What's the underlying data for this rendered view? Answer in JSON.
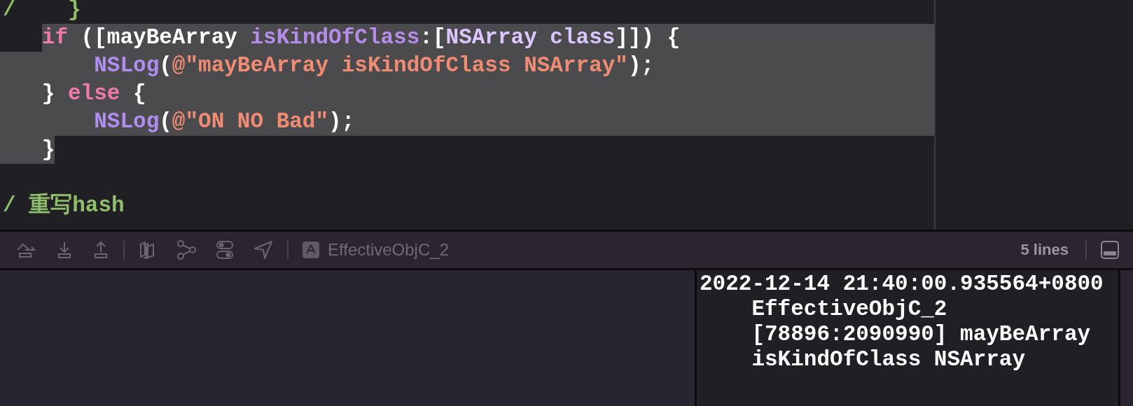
{
  "editor": {
    "lines": [
      {
        "kind": "margin",
        "selected_from_start": false,
        "selected_to_end": false,
        "tokens": [
          {
            "kind": "comment",
            "text": "/    }"
          }
        ]
      },
      {
        "kind": "block",
        "selected_from_start": false,
        "selected_to_end": true,
        "tokens": [
          {
            "kind": "keyword",
            "text": "if"
          },
          {
            "kind": "plain",
            "text": " ([mayBeArray "
          },
          {
            "kind": "method",
            "text": "isKindOfClass"
          },
          {
            "kind": "plain",
            "text": ":["
          },
          {
            "kind": "type",
            "text": "NSArray class"
          },
          {
            "kind": "plain",
            "text": "]]) {"
          }
        ]
      },
      {
        "kind": "nested",
        "selected_from_start": true,
        "selected_to_end": true,
        "tokens": [
          {
            "kind": "function",
            "text": "NSLog"
          },
          {
            "kind": "plain",
            "text": "("
          },
          {
            "kind": "string",
            "text": "@\"mayBeArray isKindOfClass NSArray\""
          },
          {
            "kind": "plain",
            "text": ");"
          }
        ]
      },
      {
        "kind": "block",
        "selected_from_start": true,
        "selected_to_end": true,
        "tokens": [
          {
            "kind": "plain",
            "text": "} "
          },
          {
            "kind": "keyword",
            "text": "else"
          },
          {
            "kind": "plain",
            "text": " {"
          }
        ]
      },
      {
        "kind": "nested",
        "selected_from_start": true,
        "selected_to_end": true,
        "tokens": [
          {
            "kind": "function",
            "text": "NSLog"
          },
          {
            "kind": "plain",
            "text": "("
          },
          {
            "kind": "string",
            "text": "@\"ON NO Bad\""
          },
          {
            "kind": "plain",
            "text": ");"
          }
        ]
      },
      {
        "kind": "block",
        "selected_from_start": true,
        "selected_to_end": false,
        "tokens": [
          {
            "kind": "plain",
            "text": "}"
          }
        ]
      },
      {
        "kind": "blank"
      },
      {
        "kind": "margin",
        "selected_from_start": false,
        "selected_to_end": false,
        "tokens": [
          {
            "kind": "comment",
            "text": "/ 重写hash"
          }
        ]
      }
    ]
  },
  "debug_bar": {
    "target": "EffectiveObjC_2",
    "line_count": "5 lines"
  },
  "console": {
    "output": "2022-12-14 21:40:00.935564+0800 EffectiveObjC_2 [78896:2090990] mayBeArray isKindOfClass NSArray"
  }
}
